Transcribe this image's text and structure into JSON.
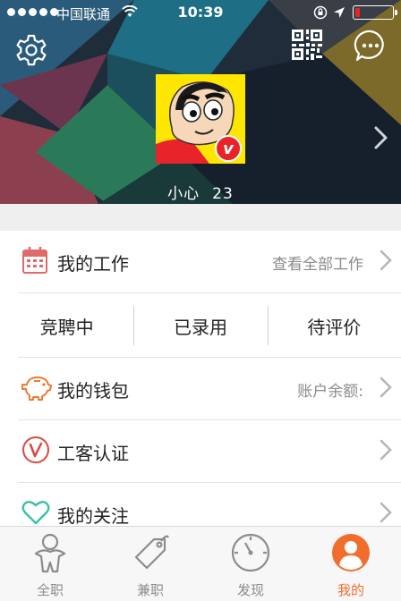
{
  "status_bar": {
    "carrier": "中国联通",
    "time": "10:39",
    "battery_level": 0.12,
    "signal_bars_filled": 5,
    "colors": {
      "battery_low": "#e8232a"
    }
  },
  "header": {
    "icons": {
      "settings": "gear-icon",
      "qr": "qr-code-icon",
      "messages": "chat-bubble-icon",
      "next": "chevron-right-icon"
    },
    "avatar_badge": "v",
    "user_name": "小心",
    "user_age": "23"
  },
  "menu": {
    "work": {
      "title": "我的工作",
      "subtitle": "查看全部工作",
      "icon": "calendar-icon"
    },
    "work_tabs": [
      "竞聘中",
      "已录用",
      "待评价"
    ],
    "wallet": {
      "title": "我的钱包",
      "subtitle": "账户余额:",
      "icon": "piggy-bank-icon"
    },
    "certify": {
      "title": "工客认证",
      "icon": "v-badge-icon"
    },
    "follow": {
      "title": "我的关注",
      "icon": "heart-icon"
    }
  },
  "tabbar": {
    "items": [
      {
        "label": "全职",
        "icon": "person-icon"
      },
      {
        "label": "兼职",
        "icon": "tag-icon"
      },
      {
        "label": "发现",
        "icon": "compass-icon"
      },
      {
        "label": "我的",
        "icon": "profile-icon"
      }
    ],
    "active_index": 3,
    "colors": {
      "active": "#f26d2c",
      "inactive": "#8c8c8c"
    }
  }
}
